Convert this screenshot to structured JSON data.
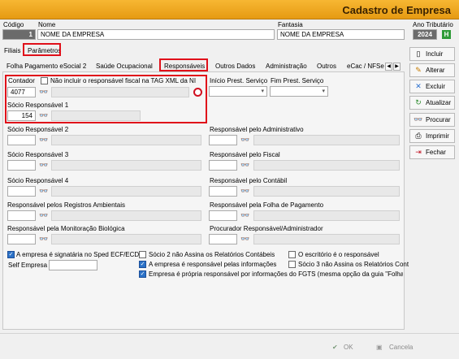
{
  "window": {
    "title": "Cadastro de Empresa"
  },
  "header": {
    "codigo_label": "Código",
    "codigo_value": "1",
    "nome_label": "Nome",
    "nome_value": "NOME DA EMPRESA",
    "fantasia_label": "Fantasia",
    "fantasia_value": "NOME DA EMPRESA",
    "ano_label": "Ano Tributário",
    "ano_value": "2024",
    "ano_icon": "H"
  },
  "top_tabs": [
    "Filiais",
    "Parâmetros"
  ],
  "sub_tabs": [
    "Folha Pagamento eSocial 2",
    "Saúde Ocupacional",
    "Responsáveis",
    "Outros Dados",
    "Administração",
    "Outros",
    "eCac / NFSe"
  ],
  "responsaveis": {
    "contador_label": "Contador",
    "contador_check_label": "Não incluir o responsável fiscal na TAG XML da NI",
    "contador_code": "4077",
    "inicio_label": "Início Prest. Serviço",
    "fim_label": "Fim Prest. Serviço",
    "socio1_label": "Sócio Responsável 1",
    "socio1_code": "154",
    "socio2_label": "Sócio Responsável 2",
    "socio3_label": "Sócio Responsável 3",
    "socio4_label": "Sócio Responsável 4",
    "amb_label": "Responsável pelos Registros Ambientais",
    "bio_label": "Responsável pela Monitoração Biológica",
    "adm_label": "Responsável pelo Administrativo",
    "fiscal_label": "Responsável pelo Fiscal",
    "contabil_label": "Responsável pelo Contábil",
    "folha_label": "Responsável pela Folha de Pagamento",
    "procurador_label": "Procurador Responsável/Administrador"
  },
  "checks": {
    "sped": "A empresa é signatária no Sped ECF/ECD",
    "socio2": "Sócio 2 não Assina os Relatórios Contábeis",
    "escritorio": "O escritório é o responsável",
    "resp_info": "A empresa é responsável pelas informações",
    "socio3": "Sócio 3 não Assina os Relatórios Cont",
    "fgts": "Empresa é própria responsável por informações do FGTS (mesma opção da guia \"Folha de F",
    "self_empresa_label": "Self Empresa"
  },
  "buttons": [
    "Incluir",
    "Alterar",
    "Excluir",
    "Atualizar",
    "Procurar",
    "Imprimir",
    "Fechar"
  ],
  "footer": {
    "ok": "OK",
    "cancel": "Cancela"
  },
  "colors": {
    "title_bar": "#f0a826",
    "highlight": "#e0101a"
  }
}
